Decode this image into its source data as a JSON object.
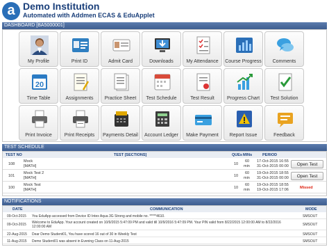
{
  "header": {
    "logo_letter": "a",
    "institution": "Demo Institution",
    "subtitle": "Automated with Addmen ECAS & EduApplet"
  },
  "dashboard": {
    "title": "DASHBOARD [BA5000001]",
    "tiles": [
      {
        "label": "My Profile",
        "icon": "student-photo-icon"
      },
      {
        "label": "Print ID",
        "icon": "id-card-icon"
      },
      {
        "label": "Admit Card",
        "icon": "admit-card-icon"
      },
      {
        "label": "Downloads",
        "icon": "download-monitor-icon"
      },
      {
        "label": "My Attendance",
        "icon": "attendance-sheet-icon"
      },
      {
        "label": "Course Progress",
        "icon": "course-progress-icon"
      },
      {
        "label": "Comments",
        "icon": "comments-icon"
      },
      {
        "label": "Time Table",
        "icon": "calendar-icon"
      },
      {
        "label": "Assignments",
        "icon": "assignments-icon"
      },
      {
        "label": "Practice Sheet",
        "icon": "practice-sheet-icon"
      },
      {
        "label": "Test Schedule",
        "icon": "test-schedule-icon"
      },
      {
        "label": "Test Result",
        "icon": "test-result-icon"
      },
      {
        "label": "Progress Chart",
        "icon": "progress-chart-icon"
      },
      {
        "label": "Test Solution",
        "icon": "test-solution-icon"
      },
      {
        "label": "Print Invoice",
        "icon": "print-invoice-icon"
      },
      {
        "label": "Print Receipts",
        "icon": "print-receipts-icon"
      },
      {
        "label": "Payments Detail",
        "icon": "card-machine-icon"
      },
      {
        "label": "Account Ledger",
        "icon": "account-ledger-icon"
      },
      {
        "label": "Make Payment",
        "icon": "make-payment-icon"
      },
      {
        "label": "Report Issue",
        "icon": "report-issue-icon"
      },
      {
        "label": "Feedback",
        "icon": "feedback-icon"
      }
    ]
  },
  "test_schedule": {
    "title": "TEST SCHEDULE",
    "columns": {
      "no": "TEST NO",
      "test": "TEST [SECTIONS]",
      "ques": "QUEs",
      "mins": "MINs",
      "period": "PERIOD"
    },
    "rows": [
      {
        "no": "108",
        "name": "Mock",
        "section": "[MATH]",
        "ques": "10",
        "mins": "60",
        "mins_unit": "min",
        "from": "17-Oct-2015 16:55",
        "to": "31-Oct-2015 00:00",
        "action": "Open Test",
        "status": ""
      },
      {
        "no": "101",
        "name": "Mock Test 2",
        "section": "[MATH]",
        "ques": "10",
        "mins": "60",
        "mins_unit": "min",
        "from": "19-Oct-2015 18:55",
        "to": "31-Oct-2015 00:00",
        "action": "Open Test",
        "status": ""
      },
      {
        "no": "100",
        "name": "Mock Test",
        "section": "[MATH]",
        "ques": "10",
        "mins": "60",
        "mins_unit": "min",
        "from": "19-Oct-2015 18:55",
        "to": "19-Oct-2015 17:06",
        "action": "",
        "status": "Missed"
      }
    ]
  },
  "notifications": {
    "title": "NOTIFICATIONS",
    "columns": {
      "date": "DATE",
      "communication": "COMMUNICATION",
      "mode": "MODE"
    },
    "rows": [
      {
        "date": "09-Oct-2015",
        "message": "You EduApp accessed from Device ID Intex Aqua 3G Strong and mobile no. *****4610.",
        "mode": "SMSOUT"
      },
      {
        "date": "09-Oct-2015",
        "message": "Welcome to EduApp. Your account created on 10/9/2015 5:47:09 PM and valid till 10/9/2016 5:47:09 PM. Your PIN valid from 8/22/2015 12:00:00 AM to 8/22/2016 12:00:00 AM",
        "mode": "SMSOUT"
      },
      {
        "date": "22-Aug-2015",
        "message": "Dear Demo Student01, You have scored 16 out of 30 in Weekly Test",
        "mode": "SMSOUT"
      },
      {
        "date": "11-Aug-2015",
        "message": "Demo Student01 was absent in Evening Class on 11-Aug-2015",
        "mode": "SMSOUT"
      }
    ]
  }
}
